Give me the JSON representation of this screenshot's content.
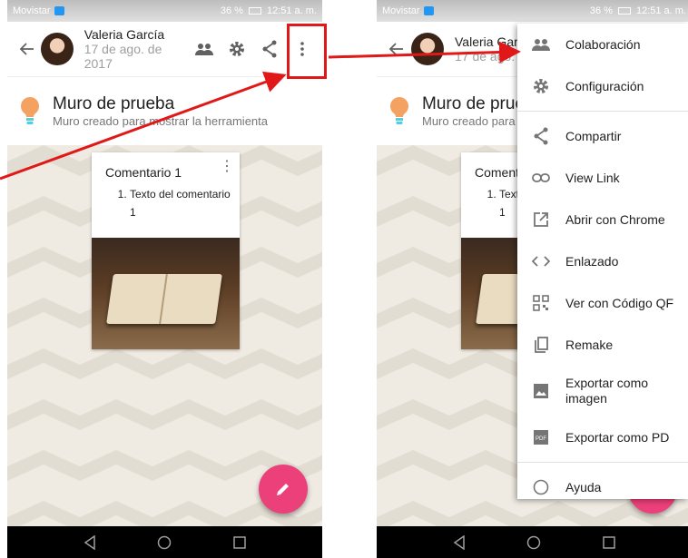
{
  "status": {
    "carrier": "Movistar",
    "battery": "36 %",
    "time": "12:51 a. m."
  },
  "user": {
    "name": "Valeria García",
    "date": "17 de ago. de 2017"
  },
  "wall": {
    "title": "Muro de prueba",
    "description": "Muro creado para mostrar la herramienta"
  },
  "card": {
    "title": "Comentario 1",
    "list_items": [
      "Texto del comentario 1"
    ]
  },
  "menu": {
    "items": [
      {
        "label": "Colaboración",
        "icon": "people-icon"
      },
      {
        "label": "Configuración",
        "icon": "gear-icon"
      },
      {
        "label": "Compartir",
        "icon": "share-icon"
      },
      {
        "label": "View Link",
        "icon": "link-icon"
      },
      {
        "label": "Abrir con Chrome",
        "icon": "open-external-icon"
      },
      {
        "label": "Enlazado",
        "icon": "code-icon"
      },
      {
        "label": "Ver con Código QF",
        "icon": "qr-code-icon"
      },
      {
        "label": "Remake",
        "icon": "copy-icon"
      },
      {
        "label": "Exportar como imagen",
        "icon": "image-icon"
      },
      {
        "label": "Exportar como PD",
        "icon": "pdf-icon"
      },
      {
        "label": "Ayuda",
        "icon": "help-icon"
      }
    ]
  },
  "colors": {
    "annotation": "#e01818",
    "fab": "#ec407a",
    "bulb": "#f4a261"
  }
}
